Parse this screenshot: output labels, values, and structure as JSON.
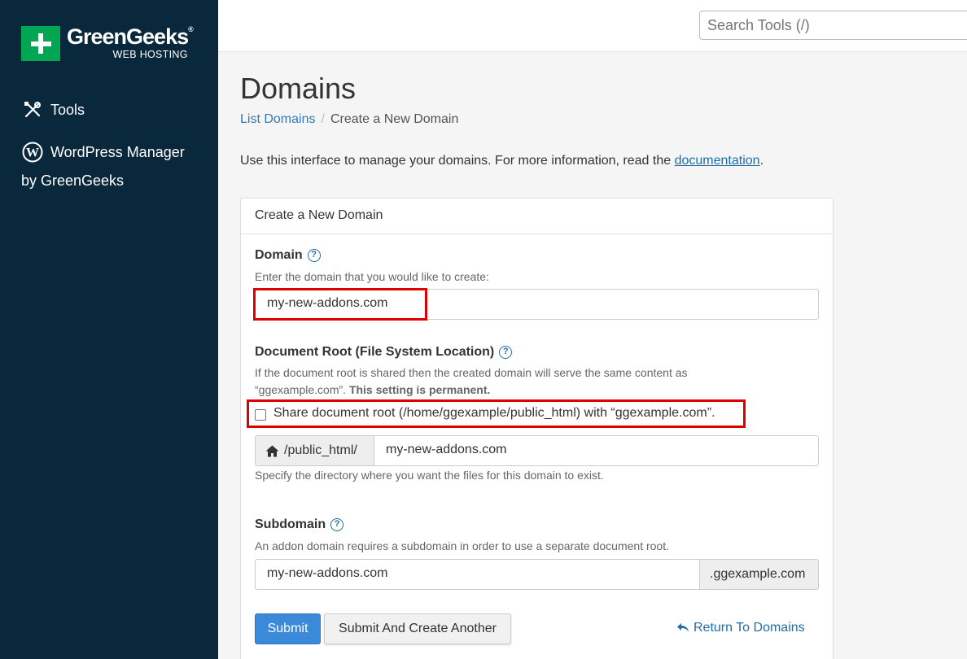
{
  "sidebar": {
    "logo_name": "GreenGeeks",
    "logo_reg": "®",
    "logo_sub": "WEB HOSTING",
    "items": [
      {
        "label": "Tools",
        "icon": "tools-icon"
      },
      {
        "label": "WordPress Manager",
        "icon": "wordpress-icon"
      }
    ],
    "wp_sub": "by GreenGeeks"
  },
  "topbar": {
    "search_placeholder": "Search Tools (/)"
  },
  "page": {
    "title": "Domains",
    "breadcrumb": {
      "link": "List Domains",
      "separator": "/",
      "current": "Create a New Domain"
    },
    "intro_text": "Use this interface to manage your domains. For more information, read the ",
    "intro_link": "documentation",
    "intro_end": "."
  },
  "form": {
    "panel_title": "Create a New Domain",
    "domain_label": "Domain",
    "domain_desc": "Enter the domain that you would like to create:",
    "domain_value": "my-new-addons.com",
    "docroot_label": "Document Root (File System Location)",
    "docroot_desc": "If the document root is shared then the created domain will serve the same content as “ggexample.com”.",
    "docroot_desc_bold": "This setting is permanent.",
    "share_label": "Share document root (/home/ggexample/public_html) with “ggexample.com”.",
    "share_checked": false,
    "docroot_prefix": "/public_html/",
    "docroot_value": "my-new-addons.com",
    "docroot_hint": "Specify the directory where you want the files for this domain to exist.",
    "subdomain_label": "Subdomain",
    "subdomain_desc": "An addon domain requires a subdomain in order to use a separate document root.",
    "subdomain_value": "my-new-addons.com",
    "subdomain_suffix": ".ggexample.com",
    "submit": "Submit",
    "submit_another": "Submit And Create Another",
    "return": "Return To Domains",
    "help_glyph": "?"
  },
  "colors": {
    "sidebar_bg": "#09283c",
    "brand_green": "#00a651",
    "highlight_red": "#e00000",
    "primary_button": "#3b8ad9",
    "link": "#1f6ea6"
  }
}
